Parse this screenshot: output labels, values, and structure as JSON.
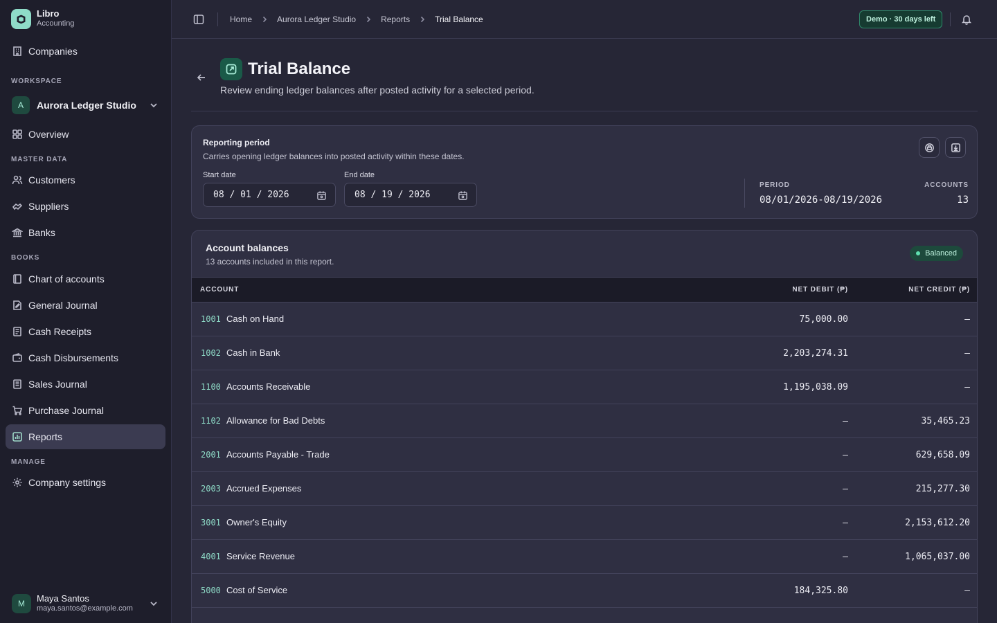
{
  "brand": {
    "name": "Libro",
    "subtitle": "Accounting"
  },
  "sidebar": {
    "companies": "Companies",
    "workspace_label": "WORKSPACE",
    "workspace_avatar": "A",
    "workspace_name": "Aurora Ledger Studio",
    "overview": "Overview",
    "master_label": "MASTER DATA",
    "master": [
      "Customers",
      "Suppliers",
      "Banks"
    ],
    "books_label": "BOOKS",
    "books": [
      "Chart of accounts",
      "General Journal",
      "Cash Receipts",
      "Cash Disbursements",
      "Sales Journal",
      "Purchase Journal",
      "Reports"
    ],
    "manage_label": "MANAGE",
    "settings": "Company settings",
    "user": {
      "avatar": "M",
      "name": "Maya Santos",
      "email": "maya.santos@example.com"
    }
  },
  "header": {
    "breadcrumb": [
      "Home",
      "Aurora Ledger Studio",
      "Reports",
      "Trial Balance"
    ],
    "demo_badge": "Demo · 30 days left"
  },
  "page": {
    "title": "Trial Balance",
    "description": "Review ending ledger balances after posted activity for a selected period."
  },
  "period": {
    "title": "Reporting period",
    "description": "Carries opening ledger balances into posted activity within these dates.",
    "start_label": "Start date",
    "start_value": "08 / 01 / 2026",
    "end_label": "End date",
    "end_value": "08 / 19 / 2026",
    "period_label": "PERIOD",
    "period_value": "08/01/2026-08/19/2026",
    "accounts_label": "ACCOUNTS",
    "accounts_value": "13"
  },
  "balances": {
    "title": "Account balances",
    "description": "13 accounts included in this report.",
    "status": "Balanced",
    "columns": {
      "account": "ACCOUNT",
      "debit": "NET DEBIT (₱)",
      "credit": "NET CREDIT (₱)"
    },
    "rows": [
      {
        "code": "1001",
        "name": "Cash on Hand",
        "debit": "75,000.00",
        "credit": "–"
      },
      {
        "code": "1002",
        "name": "Cash in Bank",
        "debit": "2,203,274.31",
        "credit": "–"
      },
      {
        "code": "1100",
        "name": "Accounts Receivable",
        "debit": "1,195,038.09",
        "credit": "–"
      },
      {
        "code": "1102",
        "name": "Allowance for Bad Debts",
        "debit": "–",
        "credit": "35,465.23"
      },
      {
        "code": "2001",
        "name": "Accounts Payable - Trade",
        "debit": "–",
        "credit": "629,658.09"
      },
      {
        "code": "2003",
        "name": "Accrued Expenses",
        "debit": "–",
        "credit": "215,277.30"
      },
      {
        "code": "3001",
        "name": "Owner's Equity",
        "debit": "–",
        "credit": "2,153,612.20"
      },
      {
        "code": "4001",
        "name": "Service Revenue",
        "debit": "–",
        "credit": "1,065,037.00"
      },
      {
        "code": "5000",
        "name": "Cost of Service",
        "debit": "184,325.80",
        "credit": "–"
      }
    ]
  }
}
